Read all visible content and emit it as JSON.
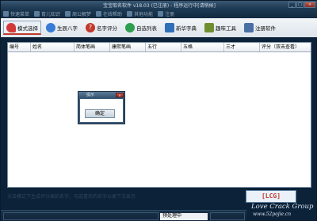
{
  "window": {
    "title": "宝宝取名软件 v18.03 (已注册) - 程序运行中[请稍候]"
  },
  "menu": {
    "items": [
      {
        "label": "快速菜单",
        "icon": "menu-icon"
      },
      {
        "label": "育儿知识",
        "icon": "book-icon"
      },
      {
        "label": "周公解梦",
        "icon": "moon-icon"
      },
      {
        "label": "在线帮助",
        "icon": "help-icon"
      },
      {
        "label": "其他功能",
        "icon": "tools-icon"
      },
      {
        "label": "注册",
        "icon": "key-icon"
      }
    ]
  },
  "toolbar": {
    "items": [
      {
        "label": "模式选择",
        "icon": "heart-icon",
        "color": "#d23a3a"
      },
      {
        "label": "生辰八字",
        "icon": "user-icon",
        "color": "#3a7bd5"
      },
      {
        "label": "名字评分",
        "icon": "question-icon",
        "color": "#c0392b"
      },
      {
        "label": "自选列表",
        "icon": "refresh-icon",
        "color": "#2e9e4f"
      },
      {
        "label": "新华字典",
        "icon": "dictionary-icon",
        "color": "#2f6fb7"
      },
      {
        "label": "趣味工具",
        "icon": "toolbox-icon",
        "color": "#6f8f2f"
      },
      {
        "label": "注册软件",
        "icon": "register-icon",
        "color": "#4a6fa5"
      }
    ]
  },
  "table": {
    "columns": [
      "编号",
      "姓名",
      "简体笔画",
      "康熙笔画",
      "五行",
      "五格",
      "三才",
      "评分（双击查看）"
    ]
  },
  "dialog": {
    "title": "提示",
    "ok_label": "确定"
  },
  "hint": "点击模式下生成评分高的名字，勾选喜欢的名字以便下次显示",
  "watermark": {
    "badge": "[LCG]",
    "brand": "Love Crack Group",
    "url": "www.52pojie.cn"
  },
  "status": {
    "text": "预处理中"
  },
  "colors": {
    "accent": "#c0392b",
    "frame": "#0c2238"
  }
}
